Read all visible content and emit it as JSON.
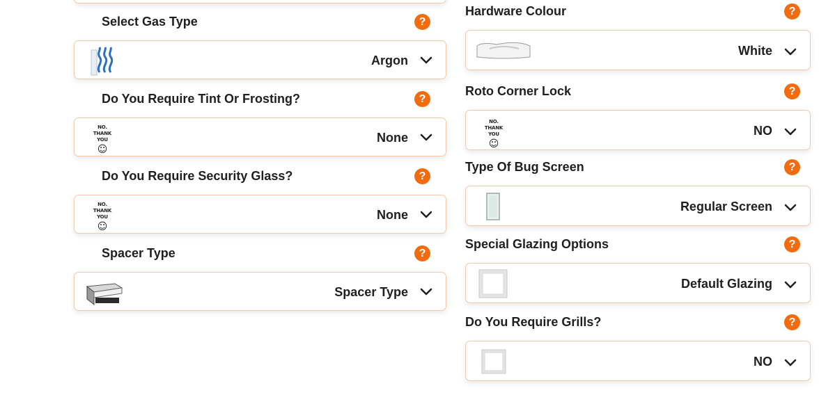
{
  "colors": {
    "accent": "#f26b0f",
    "border": "#f7c8a8",
    "text": "#1f1f1f"
  },
  "help_glyph": "?",
  "no_thanks": {
    "line1": "NO.",
    "line2": "THANK YOU",
    "smiley": "☺"
  },
  "left": [
    {
      "label": "Select Gas Type",
      "value": "Argon",
      "thumb": "argon-gas-thumbnail"
    },
    {
      "label": "Do You Require Tint Or Frosting?",
      "value": "None",
      "thumb": "no-thank-you-thumbnail"
    },
    {
      "label": "Do You Require Security Glass?",
      "value": "None",
      "thumb": "no-thank-you-thumbnail"
    },
    {
      "label": "Spacer Type",
      "value": "Spacer Type",
      "thumb": "spacer-thumbnail"
    }
  ],
  "right": [
    {
      "label": "Hardware Colour",
      "value": "White",
      "thumb": "white-hardware-thumbnail"
    },
    {
      "label": "Roto Corner Lock",
      "value": "NO",
      "thumb": "no-thank-you-thumbnail"
    },
    {
      "label": "Type Of Bug Screen",
      "value": "Regular Screen",
      "thumb": "screen-thumbnail"
    },
    {
      "label": "Special Glazing Options",
      "value": "Default Glazing",
      "thumb": "glazing-thumbnail"
    },
    {
      "label": "Do You Require Grills?",
      "value": "NO",
      "thumb": "grill-thumbnail"
    }
  ],
  "icons": {
    "help": "question-circle-icon",
    "dropdown": "chevron-down-icon"
  }
}
